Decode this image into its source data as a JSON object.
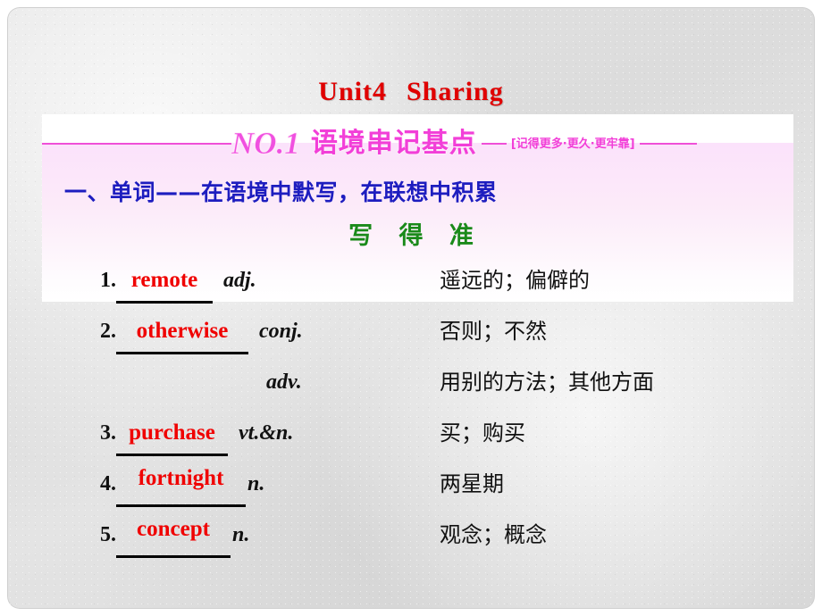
{
  "slide": {
    "title_part1": "Unit4",
    "title_part2": "Sharing",
    "background_color": "#dcdcdc"
  },
  "banner": {
    "no_label": "NO.1",
    "chinese_label": "语境串记基点",
    "dash_left": "——",
    "tag": "[记得更多·更久·更牢靠]",
    "dash_right": "——",
    "accent_color": "#f23fd8",
    "band_color": "#fbe2fb"
  },
  "section": {
    "heading": "一、单词——在语境中默写，在联想中积累",
    "heading_color": "#1d1dbf",
    "sub_heading": "写 得 准",
    "sub_heading_color": "#1a8a1a"
  },
  "vocab": {
    "word_color": "#f00000",
    "items": [
      {
        "num": "1.",
        "word": "remote",
        "pos": "adj.",
        "meaning": "遥远的；偏僻的",
        "raised": false,
        "continuation": false
      },
      {
        "num": "2.",
        "word": "otherwise",
        "pos": "conj.",
        "meaning": "否则；不然",
        "raised": false,
        "continuation": false
      },
      {
        "num": "",
        "word": "",
        "pos": "adv.",
        "meaning": "用别的方法；其他方面",
        "raised": false,
        "continuation": true
      },
      {
        "num": "3.",
        "word": "purchase",
        "pos": "vt.&n.",
        "meaning": "买；购买",
        "raised": false,
        "continuation": false
      },
      {
        "num": "4.",
        "word": "fortnight",
        "pos": "n.",
        "meaning": "两星期",
        "raised": true,
        "continuation": false
      },
      {
        "num": "5.",
        "word": "concept",
        "pos": "n.",
        "meaning": "观念；概念",
        "raised": true,
        "continuation": false
      }
    ]
  }
}
